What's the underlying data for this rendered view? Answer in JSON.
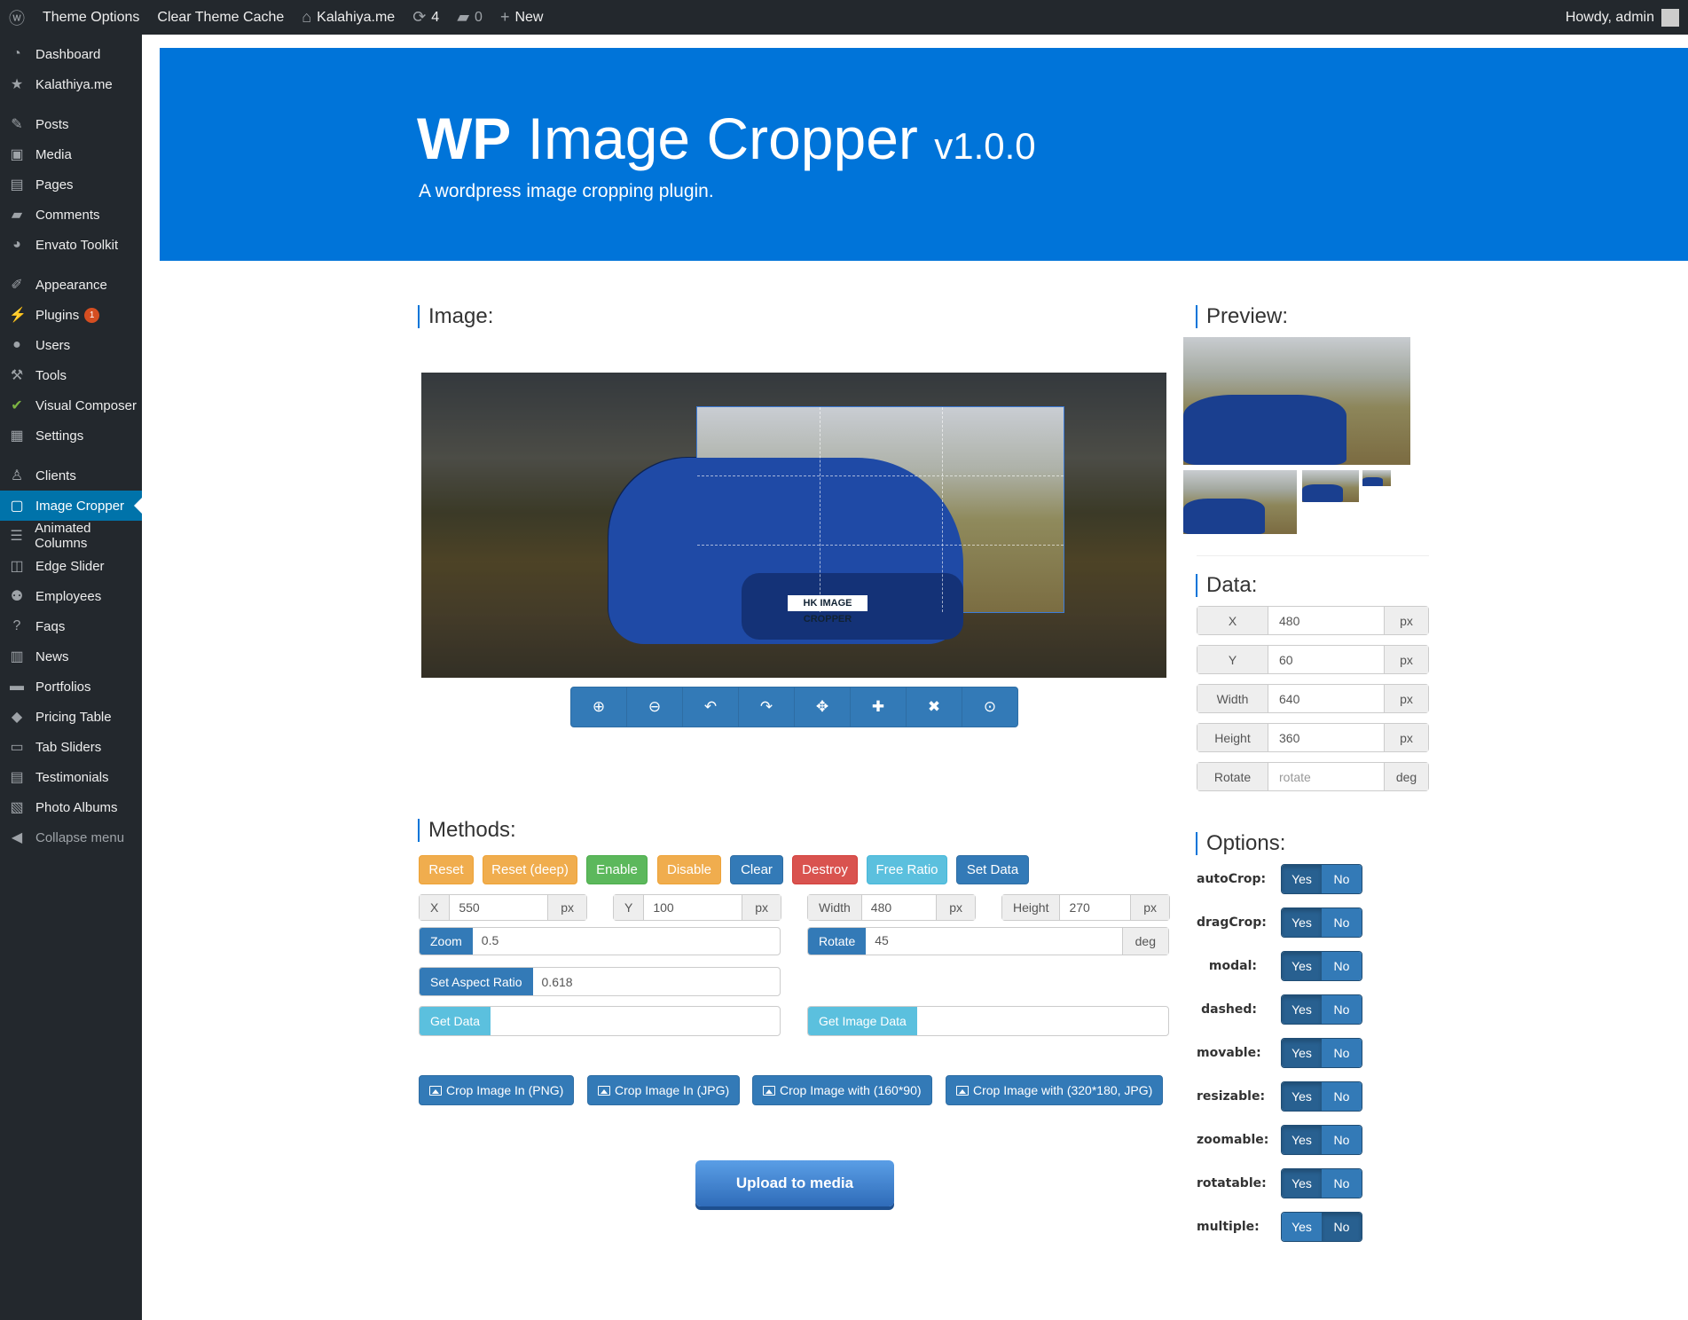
{
  "admin_bar": {
    "wp_logo": "wordpress-icon",
    "theme_options": "Theme Options",
    "clear_cache": "Clear Theme Cache",
    "site_name": "Kalahiya.me",
    "updates_count": "4",
    "comments_count": "0",
    "new_label": "New",
    "howdy": "Howdy, admin"
  },
  "sidebar": {
    "items": [
      {
        "label": "Dashboard",
        "icon": "dashboard-icon"
      },
      {
        "label": "Kalathiya.me",
        "icon": "star-icon"
      },
      {
        "label": "Posts",
        "icon": "pin-icon"
      },
      {
        "label": "Media",
        "icon": "media-icon"
      },
      {
        "label": "Pages",
        "icon": "pages-icon"
      },
      {
        "label": "Comments",
        "icon": "comment-icon"
      },
      {
        "label": "Envato Toolkit",
        "icon": "leaf-icon"
      },
      {
        "label": "Appearance",
        "icon": "brush-icon"
      },
      {
        "label": "Plugins",
        "icon": "plugin-icon",
        "badge": "1"
      },
      {
        "label": "Users",
        "icon": "user-icon"
      },
      {
        "label": "Tools",
        "icon": "wrench-icon"
      },
      {
        "label": "Visual Composer",
        "icon": "vc-icon"
      },
      {
        "label": "Settings",
        "icon": "settings-icon"
      },
      {
        "label": "Clients",
        "icon": "clients-icon"
      },
      {
        "label": "Image Cropper",
        "icon": "crop-icon"
      },
      {
        "label": "Animated Columns",
        "icon": "columns-icon"
      },
      {
        "label": "Edge Slider",
        "icon": "slider-icon"
      },
      {
        "label": "Employees",
        "icon": "employees-icon"
      },
      {
        "label": "Faqs",
        "icon": "question-icon"
      },
      {
        "label": "News",
        "icon": "news-icon"
      },
      {
        "label": "Portfolios",
        "icon": "folder-icon"
      },
      {
        "label": "Pricing Table",
        "icon": "tag-icon"
      },
      {
        "label": "Tab Sliders",
        "icon": "tabs-icon"
      },
      {
        "label": "Testimonials",
        "icon": "testimonials-icon"
      },
      {
        "label": "Photo Albums",
        "icon": "album-icon"
      }
    ],
    "collapse": "Collapse menu"
  },
  "header": {
    "title_bold": "WP",
    "title_rest": "Image Cropper",
    "version": "v1.0.0",
    "subtitle": "A wordpress image cropping plugin."
  },
  "sections": {
    "image": "Image:",
    "preview": "Preview:",
    "data": "Data:",
    "methods": "Methods:",
    "options": "Options:"
  },
  "image": {
    "plate_text": "HK IMAGE CROPPER"
  },
  "toolbar": [
    "zoom-in-icon",
    "zoom-out-icon",
    "rotate-left-icon",
    "rotate-right-icon",
    "move-icon",
    "crop-icon",
    "close-icon",
    "upload-icon"
  ],
  "data_panel": [
    {
      "label": "X",
      "value": "480",
      "unit": "px"
    },
    {
      "label": "Y",
      "value": "60",
      "unit": "px"
    },
    {
      "label": "Width",
      "value": "640",
      "unit": "px"
    },
    {
      "label": "Height",
      "value": "360",
      "unit": "px"
    },
    {
      "label": "Rotate",
      "value": "",
      "placeholder": "rotate",
      "unit": "deg"
    }
  ],
  "methods": {
    "buttons": [
      "Reset",
      "Reset (deep)",
      "Enable",
      "Disable",
      "Clear",
      "Destroy",
      "Free Ratio",
      "Set Data"
    ],
    "x": {
      "label": "X",
      "value": "550",
      "unit": "px"
    },
    "y": {
      "label": "Y",
      "value": "100",
      "unit": "px"
    },
    "width": {
      "label": "Width",
      "value": "480",
      "unit": "px"
    },
    "height": {
      "label": "Height",
      "value": "270",
      "unit": "px"
    },
    "zoom": {
      "label": "Zoom",
      "value": "0.5"
    },
    "rotate": {
      "label": "Rotate",
      "value": "45",
      "unit": "deg"
    },
    "aspect": {
      "label": "Set Aspect Ratio",
      "value": "0.618"
    },
    "get_data": {
      "label": "Get Data",
      "value": ""
    },
    "get_image_data": {
      "label": "Get Image Data",
      "value": ""
    }
  },
  "crop_buttons": [
    "Crop Image In (PNG)",
    "Crop Image In (JPG)",
    "Crop Image with (160*90)",
    "Crop Image with (320*180, JPG)"
  ],
  "upload": "Upload to media",
  "options": [
    {
      "label": "autoCrop:",
      "selected": "Yes"
    },
    {
      "label": "dragCrop:",
      "selected": "Yes"
    },
    {
      "label": "modal:",
      "selected": "Yes"
    },
    {
      "label": "dashed:",
      "selected": "Yes"
    },
    {
      "label": "movable:",
      "selected": "Yes"
    },
    {
      "label": "resizable:",
      "selected": "Yes"
    },
    {
      "label": "zoomable:",
      "selected": "Yes"
    },
    {
      "label": "rotatable:",
      "selected": "Yes"
    },
    {
      "label": "multiple:",
      "selected": "No"
    }
  ],
  "toggle": {
    "yes": "Yes",
    "no": "No"
  },
  "colors": {
    "admin_bar": "#23282d",
    "accent": "#0074d9",
    "primary": "#337ab7",
    "warning": "#f0ad4e",
    "success": "#5cb85c",
    "danger": "#d9534f",
    "info": "#5bc0de"
  }
}
